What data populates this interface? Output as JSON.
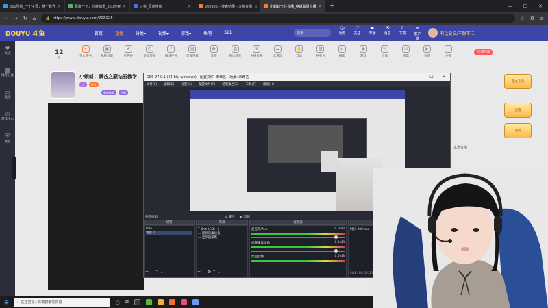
{
  "browser": {
    "tabs": [
      {
        "title": "360导航_一个主页，整个世界",
        "color": "#3c9be8"
      },
      {
        "title": "百度一下，你就知道_360搜索",
        "color": "#5bb25b"
      },
      {
        "title": "斗鱼_百度搜索",
        "color": "#4a6ef0"
      },
      {
        "title": "208925 - 搜索结果 - 斗鱼直播",
        "color": "#ff7a2c"
      },
      {
        "title": "小蝌蚪卡在直播_英雄联盟直播",
        "color": "#ff7a2c",
        "active": true
      }
    ],
    "url": "https://www.douyu.com/208925",
    "new_tab": "+",
    "window_controls": [
      "—",
      "☐",
      "✕"
    ]
  },
  "douyu": {
    "logo": "DOUYU 斗鱼",
    "nav": [
      {
        "label": "首页"
      },
      {
        "label": "直播",
        "active": true
      },
      {
        "label": "分类▾"
      },
      {
        "label": "视频▾"
      },
      {
        "label": "游戏▾"
      },
      {
        "label": "鱼吧"
      },
      {
        "label": "S11"
      }
    ],
    "search_placeholder": "搜索",
    "header_icons": [
      {
        "icon": "history-icon",
        "glyph": "◷",
        "label": "历史"
      },
      {
        "icon": "follow-icon",
        "glyph": "♡",
        "label": "关注"
      },
      {
        "icon": "video-icon",
        "glyph": "▶",
        "label": "开播"
      },
      {
        "icon": "message-icon",
        "glyph": "✉",
        "label": "消息"
      },
      {
        "icon": "download-icon",
        "glyph": "⇩",
        "label": "下载"
      },
      {
        "icon": "location-icon",
        "glyph": "⌖",
        "label": "客户端"
      }
    ],
    "username": "有话要说/不想不江",
    "sidebar": [
      {
        "icon": "heart-icon",
        "glyph": "♥",
        "label": "关注"
      },
      {
        "icon": "category-icon",
        "glyph": "▦",
        "label": "推荐分类"
      },
      {
        "icon": "tv-icon",
        "glyph": "▭",
        "label": "直播"
      },
      {
        "icon": "game-icon",
        "glyph": "◎",
        "label": "游戏中心"
      },
      {
        "icon": "shield-icon",
        "glyph": "⛨",
        "label": "更多"
      }
    ],
    "count_label": "12",
    "count_sub": "日",
    "icon_row": [
      {
        "icon": "gift-icon",
        "label": "鱼丸任务"
      },
      {
        "icon": "bag-icon",
        "label": "礼物领取"
      },
      {
        "icon": "star-icon",
        "label": "星守护"
      },
      {
        "icon": "clock-icon",
        "label": "连续签到"
      },
      {
        "icon": "task-icon",
        "label": "每日任务"
      },
      {
        "icon": "card-icon",
        "label": "贵族特权"
      },
      {
        "icon": "paw-icon",
        "label": "宠物"
      },
      {
        "icon": "chart-icon",
        "label": "粉丝榜单"
      },
      {
        "icon": "trophy-icon",
        "label": "主播竞赛"
      },
      {
        "icon": "cloud-icon",
        "label": "云游戏"
      },
      {
        "icon": "hand-icon",
        "label": "互动"
      },
      {
        "icon": "box-icon",
        "label": "任务包"
      },
      {
        "icon": "compass-icon",
        "label": "探索"
      },
      {
        "icon": "gamepad-icon",
        "label": "游戏"
      },
      {
        "icon": "edit-icon",
        "label": "创作"
      },
      {
        "icon": "vote-icon",
        "label": "投票"
      },
      {
        "icon": "play-icon",
        "label": "视频"
      },
      {
        "icon": "more-icon",
        "label": "更多"
      }
    ],
    "streamer_title": "小蝌蚪：磺谷之巅钻石教学",
    "streamer_tags": [
      "LV",
      "关注",
      "英雄联盟",
      "主播"
    ],
    "pc_badge": "PC客户端",
    "gift_badges": [
      "鱼丸礼包",
      "宝箱",
      "活动"
    ],
    "side_text": "本场直播"
  },
  "obs": {
    "title": "OBS 27.0.1 (64-bit, windows) - 配置文件: 未命名 - 场景: 未命名",
    "menu": [
      "文件(F)",
      "编辑(E)",
      "视图(V)",
      "配置文件(P)",
      "场景集合(S)",
      "工具(T)",
      "帮助(H)"
    ],
    "no_source": "未选择源",
    "props_button": "属性",
    "filter_button": "滤镜",
    "scenes_header": "场景",
    "sources_header": "来源",
    "mixer_header": "混音器",
    "transitions_header": "转场",
    "scenes": [
      "OBS",
      "场景 2"
    ],
    "sources": [
      "文本 (GDI+)",
      "视频采集设备",
      "显示器采集"
    ],
    "mixer": [
      {
        "name": "麦克风/Aux",
        "db": "0.0 dB"
      },
      {
        "name": "视频采集设备",
        "db": "0.0 dB"
      },
      {
        "name": "桌面音频",
        "db": "0.0 dB"
      }
    ],
    "status": [
      "LIVE: 00:00:00",
      "REC: 00:00:00"
    ],
    "duration_label": "时长",
    "duration_value": "300 ms"
  },
  "taskbar": {
    "search_placeholder": "在这里输入你要搜索的内容"
  }
}
